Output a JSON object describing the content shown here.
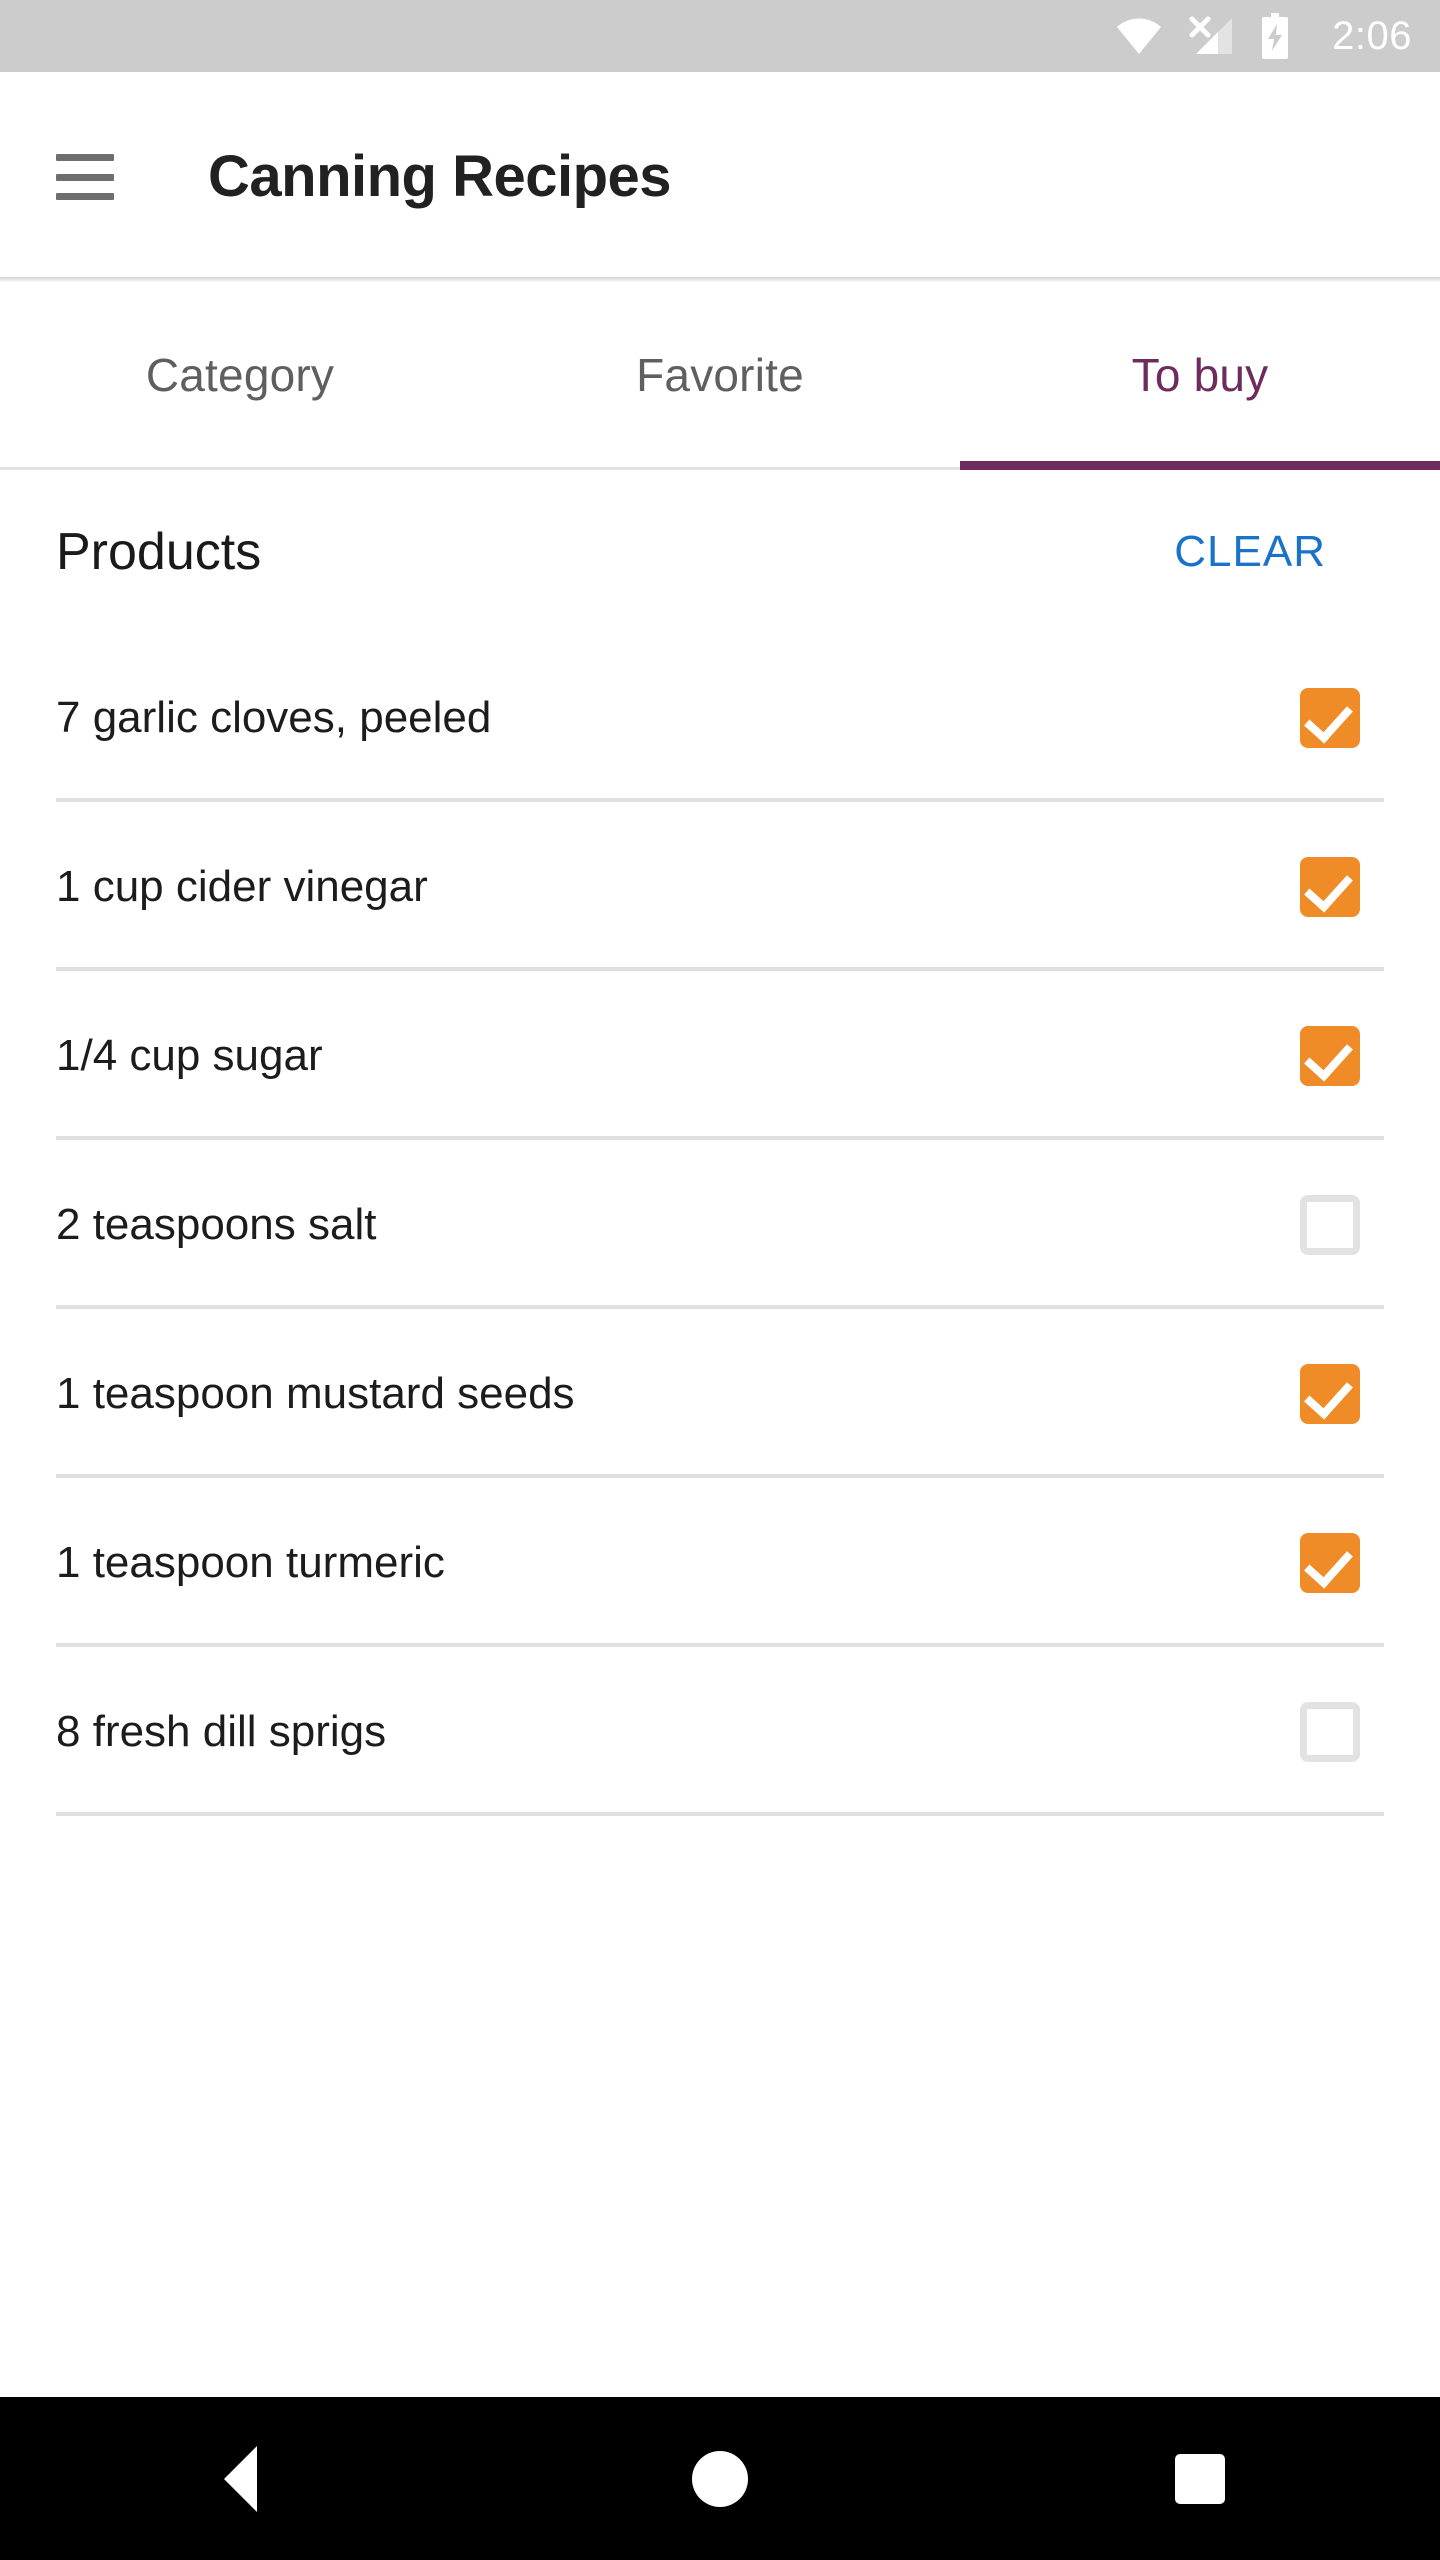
{
  "status_bar": {
    "time": "2:06",
    "icons": [
      "wifi-icon",
      "cellular-no-sim-icon",
      "battery-charging-icon"
    ],
    "background": "#cccccc"
  },
  "app_bar": {
    "menu_icon": "hamburger-menu-icon",
    "title": "Canning Recipes"
  },
  "tabs": {
    "active_index": 2,
    "items": [
      {
        "label": "Category",
        "active": false
      },
      {
        "label": "Favorite",
        "active": false
      },
      {
        "label": "To buy",
        "active": true
      }
    ],
    "active_color": "#6d2c5e",
    "inactive_color": "#5f5f5f"
  },
  "section": {
    "title": "Products",
    "clear_label": "CLEAR",
    "clear_color": "#1a73c8"
  },
  "products": [
    {
      "label": "7 garlic cloves, peeled",
      "checked": true
    },
    {
      "label": "1 cup cider vinegar",
      "checked": true
    },
    {
      "label": "1/4 cup sugar",
      "checked": true
    },
    {
      "label": "2 teaspoons salt",
      "checked": false
    },
    {
      "label": "1 teaspoon mustard seeds",
      "checked": true
    },
    {
      "label": "1 teaspoon turmeric",
      "checked": true
    },
    {
      "label": "8 fresh dill sprigs",
      "checked": false
    }
  ],
  "checkbox_colors": {
    "checked_fill": "#f08c27",
    "unchecked_border": "#e2e2e2",
    "check_mark": "#ffffff"
  },
  "nav_bar": {
    "background": "#000000",
    "buttons": [
      {
        "name": "back-button",
        "icon": "triangle-left-icon"
      },
      {
        "name": "home-button",
        "icon": "circle-icon"
      },
      {
        "name": "recents-button",
        "icon": "square-icon"
      }
    ]
  }
}
